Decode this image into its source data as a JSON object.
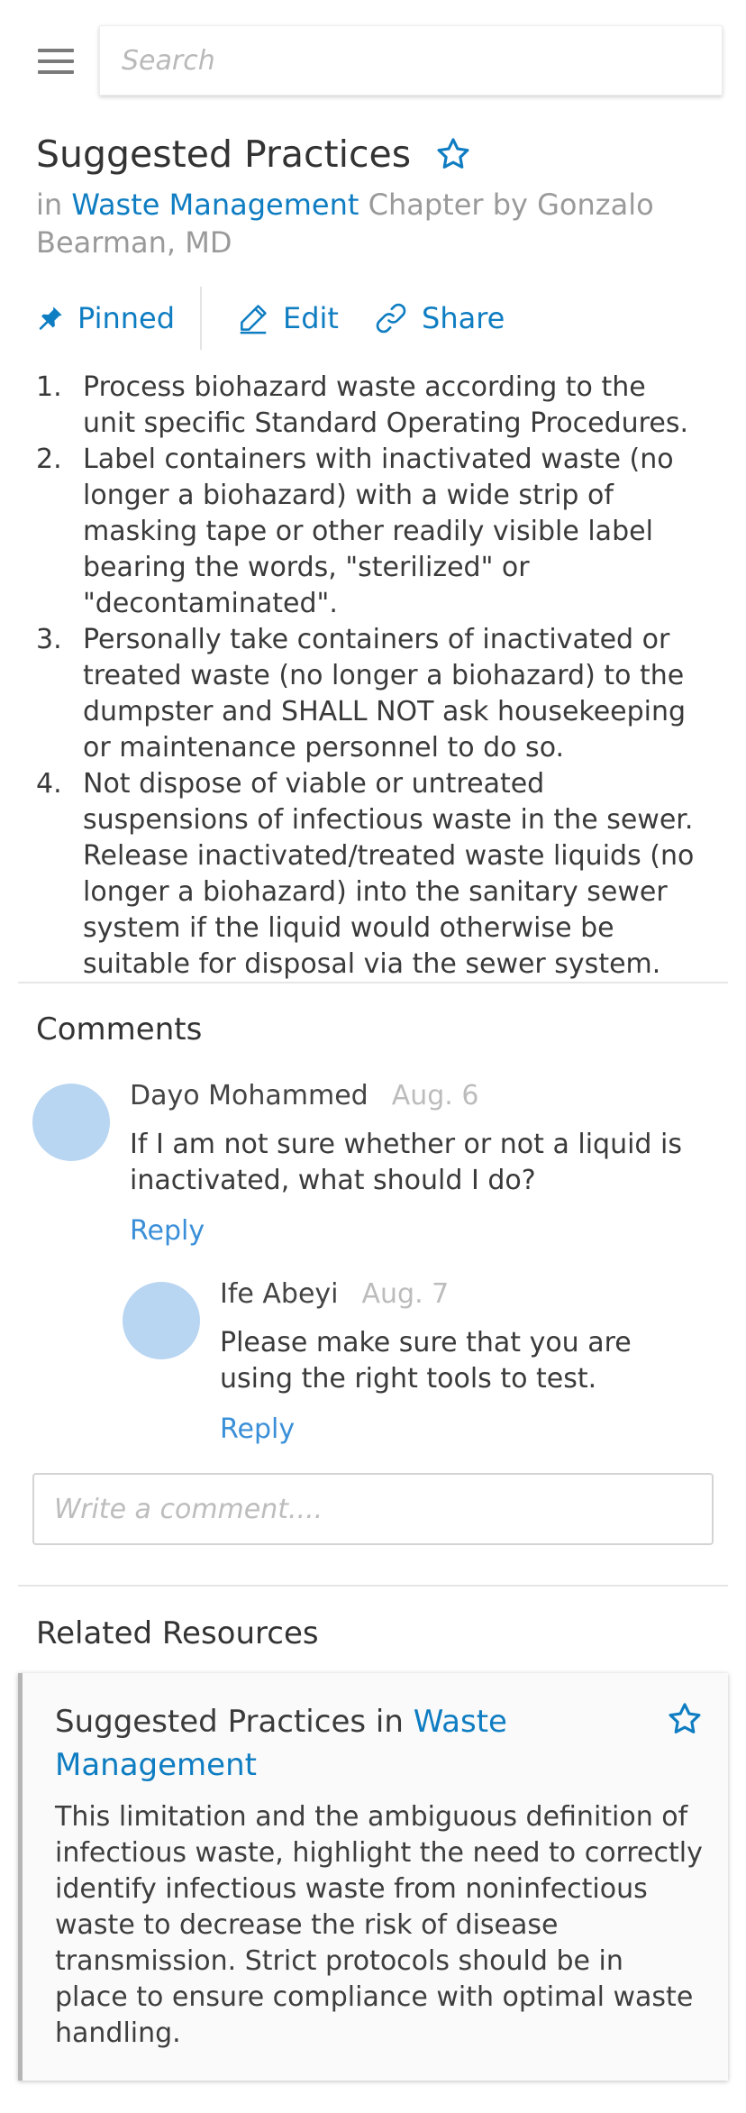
{
  "search": {
    "placeholder": "Search"
  },
  "article": {
    "title": "Suggested Practices",
    "byline_prefix": "in",
    "category": "Waste Management",
    "byline_suffix": "Chapter by Gonzalo Bearman, MD"
  },
  "actions": {
    "pinned": "Pinned",
    "edit": "Edit",
    "share": "Share"
  },
  "practices": [
    {
      "num": "1.",
      "text": "Process biohazard waste according to the unit specific Standard Operating Procedures."
    },
    {
      "num": "2.",
      "text": "Label containers with inactivated waste (no longer a biohazard) with a wide strip of masking tape or other readily visible label bearing the words, \"sterilized\" or \"decontaminated\"."
    },
    {
      "num": "3.",
      "text": "Personally take containers of inactivated or treated waste (no longer a biohazard) to the dumpster and SHALL NOT ask housekeeping or maintenance personnel to do so."
    },
    {
      "num": "4.",
      "text": "Not dispose of viable or untreated suspensions of infectious waste in the sewer. Release inactivated/treated waste liquids (no longer a biohazard) into the sanitary sewer system if the liquid would otherwise be suitable for disposal via the sewer system."
    }
  ],
  "comments": {
    "heading": "Comments",
    "items": [
      {
        "author": "Dayo Mohammed",
        "date": "Aug. 6",
        "text": "If I am not sure whether or not a liquid is inactivated, what should I do?",
        "reply": "Reply"
      },
      {
        "author": "Ife Abeyi",
        "date": "Aug. 7",
        "text": "Please make sure that you are using the right tools to test.",
        "reply": "Reply"
      }
    ],
    "input_placeholder": "Write a comment...."
  },
  "related": {
    "heading": "Related Resources",
    "card": {
      "title": "Suggested Practices",
      "in": "in",
      "category": "Waste Management",
      "body": "This limitation and the ambiguous definition of infectious waste, highlight the need to correctly identify infectious waste from noninfectious waste to decrease the risk of disease transmission. Strict protocols should be in place to ensure compliance with optimal waste handling."
    }
  },
  "colors": {
    "accent": "#0f7dc2",
    "reply": "#3a8fd8",
    "avatar": "#b8d5f2",
    "muted": "#9a9a9a"
  },
  "icons": [
    "hamburger-menu-icon",
    "star-outline-icon",
    "pin-icon",
    "pencil-icon",
    "link-icon"
  ]
}
